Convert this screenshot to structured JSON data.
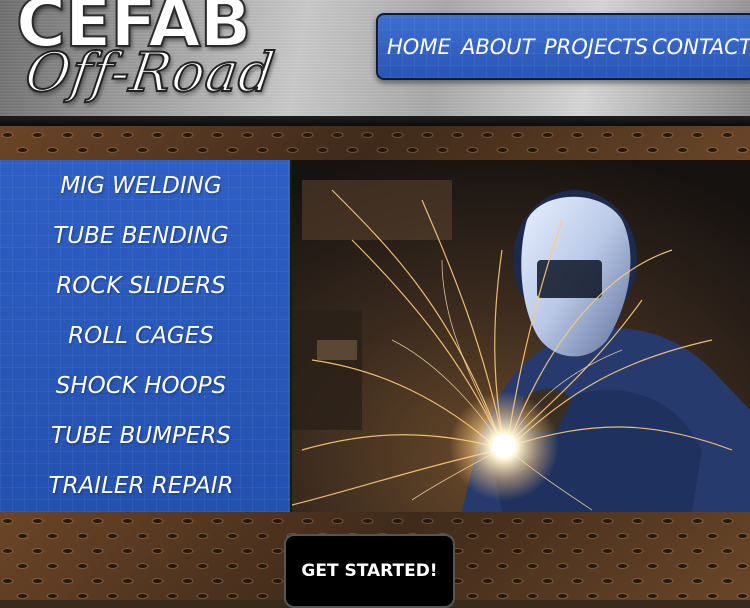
{
  "brand": {
    "name": "CEFAB",
    "tagline": "Off-Road"
  },
  "nav": {
    "items": [
      {
        "label": "HOME"
      },
      {
        "label": "ABOUT"
      },
      {
        "label": "PROJECTS"
      },
      {
        "label": "CONTACT"
      }
    ]
  },
  "services": {
    "items": [
      {
        "label": "MIG WELDING"
      },
      {
        "label": "TUBE BENDING"
      },
      {
        "label": "ROCK SLIDERS"
      },
      {
        "label": "ROLL CAGES"
      },
      {
        "label": "SHOCK HOOPS"
      },
      {
        "label": "TUBE BUMPERS"
      },
      {
        "label": "TRAILER REPAIR"
      }
    ]
  },
  "cta": {
    "label": "GET STARTED!"
  },
  "colors": {
    "accent_blue": "#2e5fc4",
    "steel": "#b5b5b5",
    "plate": "#5a3b22"
  }
}
